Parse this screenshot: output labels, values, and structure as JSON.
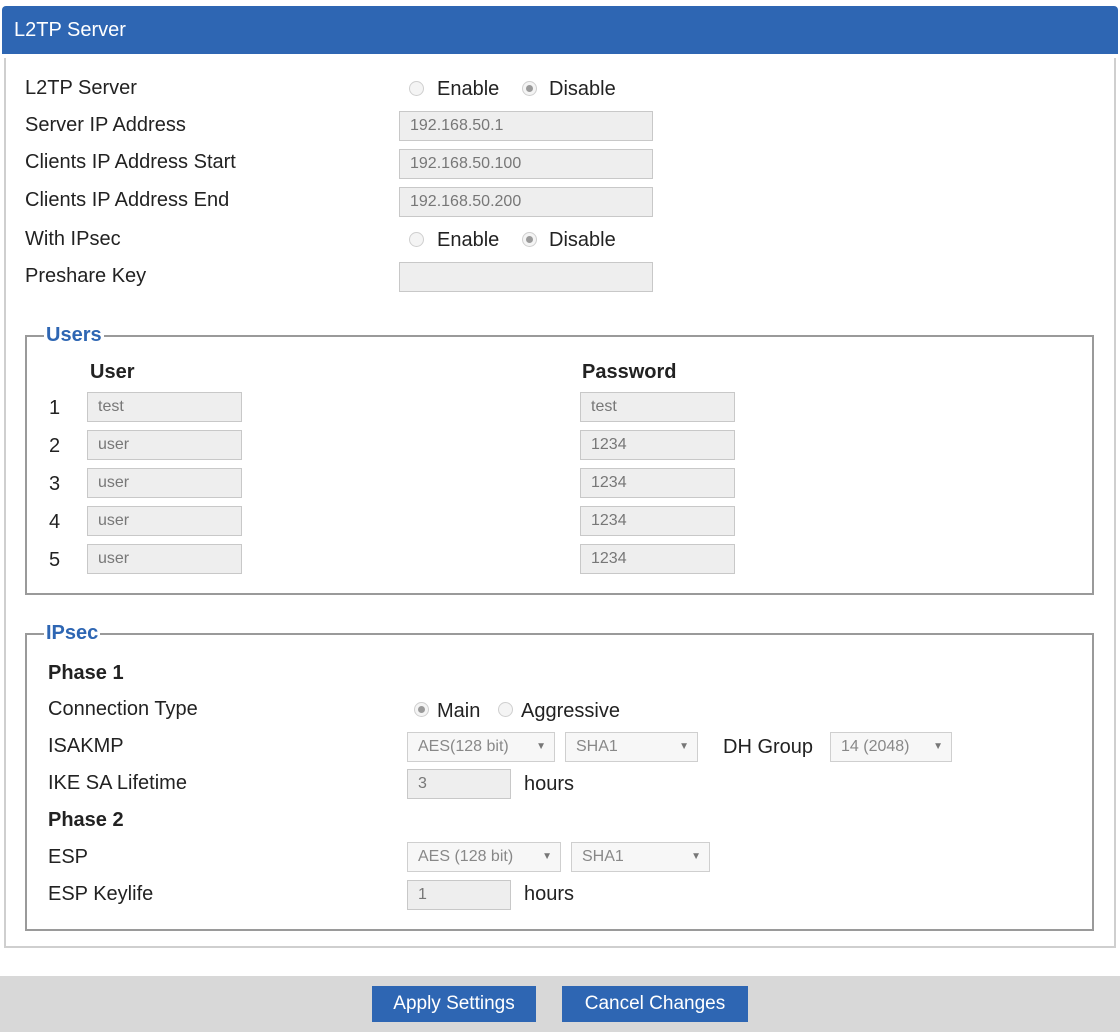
{
  "header": {
    "title": "L2TP Server"
  },
  "server": {
    "l2tp_label": "L2TP Server",
    "enable_label": "Enable",
    "disable_label": "Disable",
    "l2tp_selected": "Disable",
    "server_ip_label": "Server IP Address",
    "server_ip_value": "192.168.50.1",
    "clients_start_label": "Clients IP Address Start",
    "clients_start_value": "192.168.50.100",
    "clients_end_label": "Clients IP Address End",
    "clients_end_value": "192.168.50.200",
    "ipsec_label": "With IPsec",
    "ipsec_selected": "Disable",
    "preshare_label": "Preshare Key",
    "preshare_value": ""
  },
  "users": {
    "legend": "Users",
    "col_user": "User",
    "col_password": "Password",
    "rows": [
      {
        "num": "1",
        "user": "test",
        "password": "test"
      },
      {
        "num": "2",
        "user": "user",
        "password": "1234"
      },
      {
        "num": "3",
        "user": "user",
        "password": "1234"
      },
      {
        "num": "4",
        "user": "user",
        "password": "1234"
      },
      {
        "num": "5",
        "user": "user",
        "password": "1234"
      }
    ]
  },
  "ipsec": {
    "legend": "IPsec",
    "phase1_label": "Phase 1",
    "connection_type_label": "Connection Type",
    "main_label": "Main",
    "aggressive_label": "Aggressive",
    "connection_selected": "Main",
    "isakmp_label": "ISAKMP",
    "isakmp_encryption": "AES(128 bit)",
    "isakmp_hash": "SHA1",
    "dh_group_label": "DH Group",
    "dh_group_value": "14 (2048)",
    "ike_lifetime_label": "IKE SA Lifetime",
    "ike_lifetime_value": "3",
    "hours_label": "hours",
    "phase2_label": "Phase 2",
    "esp_label": "ESP",
    "esp_encryption": "AES (128 bit)",
    "esp_hash": "SHA1",
    "esp_keylife_label": "ESP Keylife",
    "esp_keylife_value": "1"
  },
  "footer": {
    "apply_label": "Apply Settings",
    "cancel_label": "Cancel Changes"
  },
  "colors": {
    "accent": "#2e66b3",
    "footer_bg": "#d8d8d8",
    "field_bg": "#eeeeee"
  }
}
